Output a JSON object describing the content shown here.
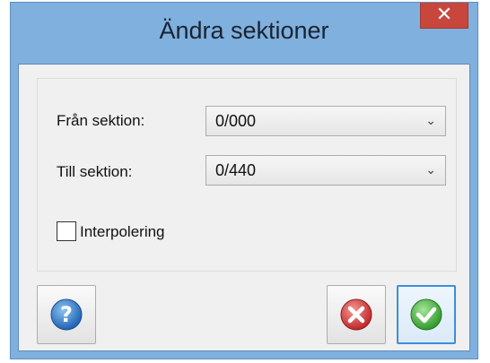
{
  "window": {
    "title": "Ändra sektioner",
    "close_glyph": "✕"
  },
  "form": {
    "from_label": "Från sektion:",
    "from_value": "0/000",
    "to_label": "Till sektion:",
    "to_value": "0/440",
    "interpolate_label": "Interpolering",
    "interpolate_checked": false
  },
  "buttons": {
    "help_icon": "question-icon",
    "cancel_icon": "red-x-icon",
    "ok_icon": "green-check-icon"
  },
  "colors": {
    "titlebar": "#7fb0de",
    "close": "#c9463d",
    "help": "#2f7fd0",
    "cancel": "#d9413b",
    "ok": "#46b43f"
  }
}
